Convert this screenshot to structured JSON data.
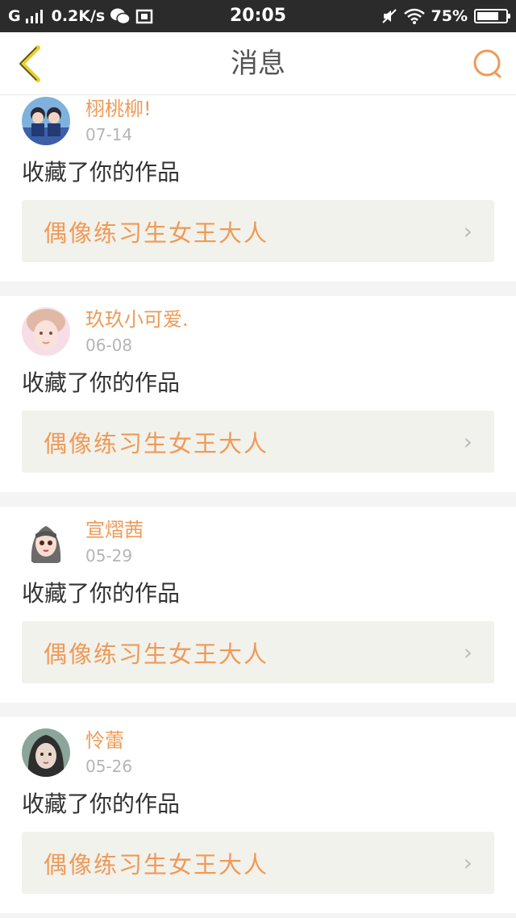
{
  "status_bar": {
    "carrier": "G",
    "speed": "0.2K/s",
    "time": "20:05",
    "battery": "75%",
    "battery_level": 0.75
  },
  "header": {
    "title": "消息",
    "back_icon": "chevron-left-icon",
    "search_icon": "search-icon"
  },
  "colors": {
    "accent": "#ef9a57",
    "back_icon": "#e8cf30",
    "card_link_bg": "#f2f2ec"
  },
  "messages": [
    {
      "user": "栩桃柳!",
      "date": "07-14",
      "action": "收藏了你的作品",
      "work": "偶像练习生女王大人"
    },
    {
      "user": "玖玖小可爱.",
      "date": "06-08",
      "action": "收藏了你的作品",
      "work": "偶像练习生女王大人"
    },
    {
      "user": "宣熠茜",
      "date": "05-29",
      "action": "收藏了你的作品",
      "work": "偶像练习生女王大人"
    },
    {
      "user": "怜蕾",
      "date": "05-26",
      "action": "收藏了你的作品",
      "work": "偶像练习生女王大人"
    }
  ]
}
